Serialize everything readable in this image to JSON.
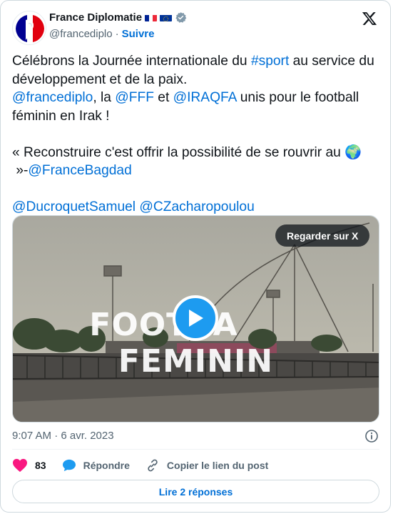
{
  "author": {
    "display_name": "France Diplomatie",
    "handle": "@francediplo",
    "separator": "·",
    "follow_label": "Suivre",
    "verified_color": "#829aab"
  },
  "tweet": {
    "line1_pre": "Célébrons la Journée internationale du ",
    "hashtag_sport": "#sport",
    "line1_post": " au service du développement et de la paix.",
    "mention_francediplo": "@francediplo",
    "sep1": ", la ",
    "mention_fff": "@FFF",
    "sep2": " et ",
    "mention_iraqfa": "@IRAQFA",
    "line2_post": " unis pour le football féminin en Irak !",
    "quote_pre": "« Reconstruire c'est offrir la possibilité de se rouvrir au ",
    "globe_emoji": "🌍",
    "quote_post": " »-",
    "mention_bagdad": "@FranceBagdad",
    "mention_ducroquet": "@DucroquetSamuel",
    "space": " ",
    "mention_zacharopoulou": "@CZacharopoulou"
  },
  "media": {
    "watch_label": "Regarder sur X",
    "overlay_left": "FOOTBA",
    "overlay_right": "FEMININ"
  },
  "meta": {
    "timestamp": "9:07 AM · 6 avr. 2023"
  },
  "actions": {
    "likes_count": "83",
    "reply_label": "Répondre",
    "copy_label": "Copier le lien du post"
  },
  "read_replies_label": "Lire 2 réponses",
  "colors": {
    "link": "#006fd6",
    "like": "#f91880",
    "reply": "#1d9bf0",
    "play": "#1d9bf0"
  }
}
